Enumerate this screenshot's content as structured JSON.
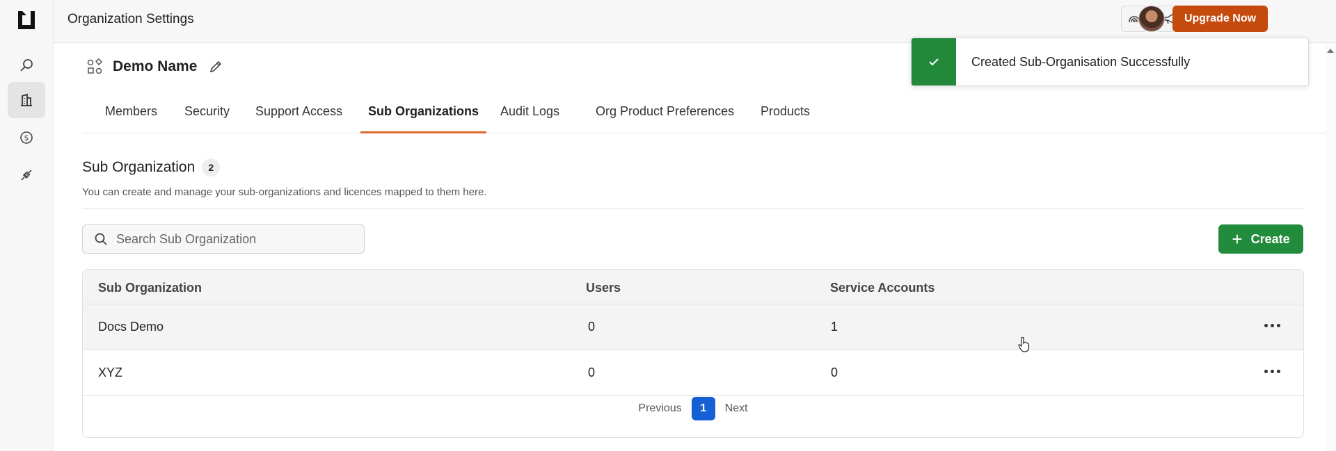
{
  "topbar": {
    "title": "Organization Settings",
    "upgrade_label": "Upgrade Now"
  },
  "rail": {
    "items": [
      "search-icon",
      "building-icon",
      "dollar-icon",
      "plug-icon"
    ],
    "active_item": "building-icon"
  },
  "org": {
    "name": "Demo Name"
  },
  "tabs": [
    {
      "label": "Members"
    },
    {
      "label": "Security"
    },
    {
      "label": "Support Access"
    },
    {
      "label": "Sub Organizations",
      "active": true
    },
    {
      "label": "Audit Logs"
    },
    {
      "label": "Org Product Preferences"
    },
    {
      "label": "Products"
    }
  ],
  "section": {
    "title": "Sub Organization",
    "count": "2",
    "description": "You can create and manage your sub-organizations and licences mapped to them here."
  },
  "search": {
    "placeholder": "Search Sub Organization"
  },
  "create_label": "Create",
  "table": {
    "columns": [
      "Sub Organization",
      "Users",
      "Service Accounts"
    ],
    "rows": [
      {
        "name": "Docs Demo",
        "users": "0",
        "service_accounts": "1"
      },
      {
        "name": "XYZ",
        "users": "0",
        "service_accounts": "0"
      }
    ]
  },
  "pagination": {
    "previous": "Previous",
    "current": "1",
    "next": "Next"
  },
  "toast": {
    "message": "Created Sub-Organisation Successfully"
  },
  "colors": {
    "accent": "#e0692a",
    "upgrade": "#c54a0d",
    "success": "#218c3c",
    "page_active": "#1660d6"
  }
}
